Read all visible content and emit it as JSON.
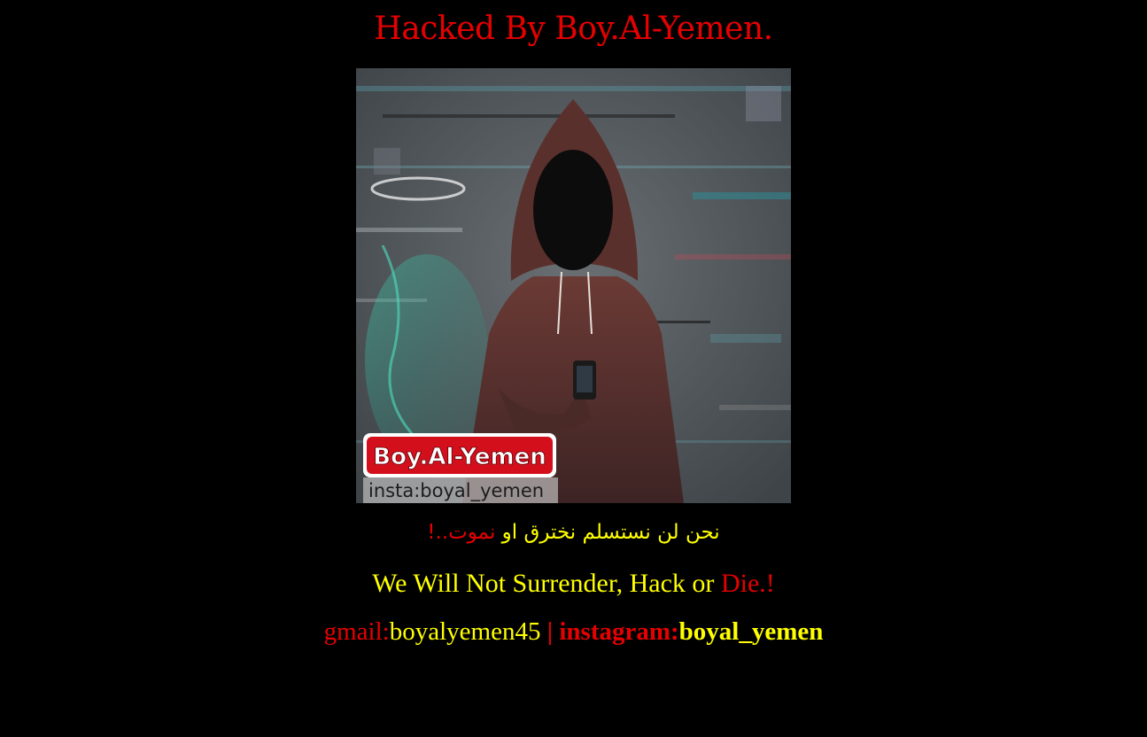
{
  "title": "Hacked By Boy.Al-Yemen.",
  "hero_image": {
    "badge_name": "Boy.Al-Yemen",
    "badge_handle": "insta:boyal_yemen"
  },
  "arabic_line": {
    "yellow_part": "نحن لن نستسلم نخترق او",
    "red_part": "نموت..!"
  },
  "motto": {
    "yellow_part": "We Will Not Surrender, Hack or",
    "red_part": "Die.!"
  },
  "contact": {
    "gmail_label": "gmail:",
    "gmail_value": "boyalyemen45",
    "separator": "|",
    "instagram_label": "instagram:",
    "instagram_value": "boyal_yemen"
  },
  "colors": {
    "background": "#000000",
    "red": "#e60000",
    "yellow": "#ffff00"
  }
}
